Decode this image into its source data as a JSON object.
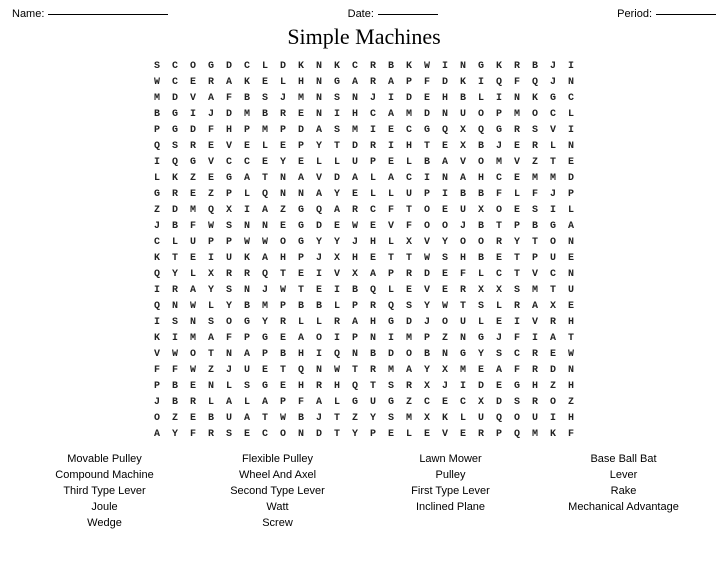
{
  "header": {
    "name_label": "Name:",
    "date_label": "Date:",
    "period_label": "Period:"
  },
  "title": "Simple Machines",
  "grid": [
    [
      "S",
      "C",
      "O",
      "G",
      "D",
      "C",
      "L",
      "D",
      "K",
      "N",
      "K",
      "C",
      "R",
      "B",
      "K",
      "W",
      "I",
      "N",
      "G",
      "K",
      "R",
      "B",
      "J",
      "I"
    ],
    [
      "W",
      "C",
      "E",
      "R",
      "A",
      "K",
      "E",
      "L",
      "H",
      "N",
      "G",
      "A",
      "R",
      "A",
      "P",
      "F",
      "D",
      "K",
      "I",
      "Q",
      "F",
      "Q",
      "J",
      "N"
    ],
    [
      "M",
      "D",
      "V",
      "A",
      "F",
      "B",
      "S",
      "J",
      "M",
      "N",
      "S",
      "N",
      "J",
      "I",
      "D",
      "E",
      "H",
      "B",
      "L",
      "I",
      "N",
      "K",
      "G",
      "C"
    ],
    [
      "B",
      "G",
      "I",
      "J",
      "D",
      "M",
      "B",
      "R",
      "E",
      "N",
      "I",
      "H",
      "C",
      "A",
      "M",
      "D",
      "N",
      "U",
      "O",
      "P",
      "M",
      "O",
      "C",
      "L"
    ],
    [
      "P",
      "G",
      "D",
      "F",
      "H",
      "P",
      "M",
      "P",
      "D",
      "A",
      "S",
      "M",
      "I",
      "E",
      "C",
      "G",
      "Q",
      "X",
      "Q",
      "G",
      "R",
      "S",
      "V",
      "I"
    ],
    [
      "Q",
      "S",
      "R",
      "E",
      "V",
      "E",
      "L",
      "E",
      "P",
      "Y",
      "T",
      "D",
      "R",
      "I",
      "H",
      "T",
      "E",
      "X",
      "B",
      "J",
      "E",
      "R",
      "L",
      "N"
    ],
    [
      "I",
      "Q",
      "G",
      "V",
      "C",
      "C",
      "E",
      "Y",
      "E",
      "L",
      "L",
      "U",
      "P",
      "E",
      "L",
      "B",
      "A",
      "V",
      "O",
      "M",
      "V",
      "Z",
      "T",
      "E"
    ],
    [
      "L",
      "K",
      "Z",
      "E",
      "G",
      "A",
      "T",
      "N",
      "A",
      "V",
      "D",
      "A",
      "L",
      "A",
      "C",
      "I",
      "N",
      "A",
      "H",
      "C",
      "E",
      "M",
      "M",
      "D"
    ],
    [
      "G",
      "R",
      "E",
      "Z",
      "P",
      "L",
      "Q",
      "N",
      "N",
      "A",
      "Y",
      "E",
      "L",
      "L",
      "U",
      "P",
      "I",
      "B",
      "B",
      "F",
      "L",
      "F",
      "J",
      "P"
    ],
    [
      "Z",
      "D",
      "M",
      "Q",
      "X",
      "I",
      "A",
      "Z",
      "G",
      "Q",
      "A",
      "R",
      "C",
      "F",
      "T",
      "O",
      "E",
      "U",
      "X",
      "O",
      "E",
      "S",
      "I",
      "L"
    ],
    [
      "J",
      "B",
      "F",
      "W",
      "S",
      "N",
      "N",
      "E",
      "G",
      "D",
      "E",
      "W",
      "E",
      "V",
      "F",
      "O",
      "O",
      "J",
      "B",
      "T",
      "P",
      "B",
      "G",
      "A"
    ],
    [
      "C",
      "L",
      "U",
      "P",
      "P",
      "W",
      "W",
      "O",
      "G",
      "Y",
      "Y",
      "J",
      "H",
      "L",
      "X",
      "V",
      "Y",
      "O",
      "O",
      "R",
      "Y",
      "T",
      "O",
      "N"
    ],
    [
      "K",
      "T",
      "E",
      "I",
      "U",
      "K",
      "A",
      "H",
      "P",
      "J",
      "X",
      "H",
      "E",
      "T",
      "T",
      "W",
      "S",
      "H",
      "B",
      "E",
      "T",
      "P",
      "U",
      "E"
    ],
    [
      "Q",
      "Y",
      "L",
      "X",
      "R",
      "R",
      "Q",
      "T",
      "E",
      "I",
      "V",
      "X",
      "A",
      "P",
      "R",
      "D",
      "E",
      "F",
      "L",
      "C",
      "T",
      "V",
      "C",
      "N"
    ],
    [
      "I",
      "R",
      "A",
      "Y",
      "S",
      "N",
      "J",
      "W",
      "T",
      "E",
      "I",
      "B",
      "Q",
      "L",
      "E",
      "V",
      "E",
      "R",
      "X",
      "X",
      "S",
      "M",
      "T",
      "U"
    ],
    [
      "Q",
      "N",
      "W",
      "L",
      "Y",
      "B",
      "M",
      "P",
      "B",
      "B",
      "L",
      "P",
      "R",
      "Q",
      "S",
      "Y",
      "W",
      "T",
      "S",
      "L",
      "R",
      "A",
      "X",
      "E"
    ],
    [
      "I",
      "S",
      "N",
      "S",
      "O",
      "G",
      "Y",
      "R",
      "L",
      "L",
      "R",
      "A",
      "H",
      "G",
      "D",
      "J",
      "O",
      "U",
      "L",
      "E",
      "I",
      "V",
      "R",
      "H"
    ],
    [
      "K",
      "I",
      "M",
      "A",
      "F",
      "P",
      "G",
      "E",
      "A",
      "O",
      "I",
      "P",
      "N",
      "I",
      "M",
      "P",
      "Z",
      "N",
      "G",
      "J",
      "F",
      "I",
      "A",
      "T"
    ],
    [
      "V",
      "W",
      "O",
      "T",
      "N",
      "A",
      "P",
      "B",
      "H",
      "I",
      "Q",
      "N",
      "B",
      "D",
      "O",
      "B",
      "N",
      "G",
      "Y",
      "S",
      "C",
      "R",
      "E",
      "W"
    ],
    [
      "F",
      "F",
      "W",
      "Z",
      "J",
      "U",
      "E",
      "T",
      "Q",
      "N",
      "W",
      "T",
      "R",
      "M",
      "A",
      "Y",
      "X",
      "M",
      "E",
      "A",
      "F",
      "R",
      "D",
      "N"
    ],
    [
      "P",
      "B",
      "E",
      "N",
      "L",
      "S",
      "G",
      "E",
      "H",
      "R",
      "H",
      "Q",
      "T",
      "S",
      "R",
      "X",
      "J",
      "I",
      "D",
      "E",
      "G",
      "H",
      "Z",
      "H"
    ],
    [
      "J",
      "B",
      "R",
      "L",
      "A",
      "L",
      "A",
      "P",
      "F",
      "A",
      "L",
      "G",
      "U",
      "G",
      "Z",
      "C",
      "E",
      "C",
      "X",
      "D",
      "S",
      "R",
      "O",
      "Z"
    ],
    [
      "O",
      "Z",
      "E",
      "B",
      "U",
      "A",
      "T",
      "W",
      "B",
      "J",
      "T",
      "Z",
      "Y",
      "S",
      "M",
      "X",
      "K",
      "L",
      "U",
      "Q",
      "O",
      "U",
      "I",
      "H"
    ],
    [
      "A",
      "Y",
      "F",
      "R",
      "S",
      "E",
      "C",
      "O",
      "N",
      "D",
      "T",
      "Y",
      "P",
      "E",
      "L",
      "E",
      "V",
      "E",
      "R",
      "P",
      "Q",
      "M",
      "K",
      "F"
    ]
  ],
  "word_list": [
    {
      "col": 1,
      "text": "Movable Pulley"
    },
    {
      "col": 2,
      "text": "Flexible Pulley"
    },
    {
      "col": 3,
      "text": "Lawn Mower"
    },
    {
      "col": 4,
      "text": "Base Ball Bat"
    },
    {
      "col": 1,
      "text": "Compound Machine"
    },
    {
      "col": 2,
      "text": "Wheel And Axel"
    },
    {
      "col": 3,
      "text": "Pulley"
    },
    {
      "col": 4,
      "text": "Lever"
    },
    {
      "col": 1,
      "text": "Third Type Lever"
    },
    {
      "col": 2,
      "text": "Second Type Lever"
    },
    {
      "col": 3,
      "text": "First Type Lever"
    },
    {
      "col": 4,
      "text": "Rake"
    },
    {
      "col": 1,
      "text": "Joule"
    },
    {
      "col": 2,
      "text": "Watt"
    },
    {
      "col": 3,
      "text": "Inclined Plane"
    },
    {
      "col": 4,
      "text": "Mechanical Advantage"
    },
    {
      "col": 1,
      "text": "Wedge"
    },
    {
      "col": 2,
      "text": "Screw"
    },
    {
      "col": 3,
      "text": ""
    },
    {
      "col": 4,
      "text": ""
    }
  ]
}
